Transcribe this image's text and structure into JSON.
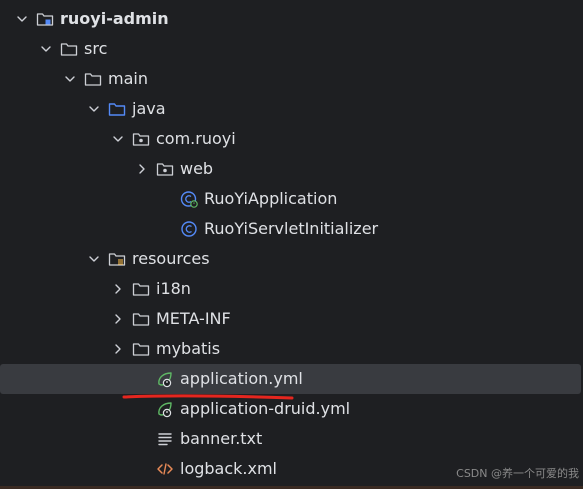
{
  "tree": [
    {
      "label": "ruoyi-admin",
      "indent": 0,
      "chevron": "down",
      "icon": "module-folder",
      "bold": true
    },
    {
      "label": "src",
      "indent": 1,
      "chevron": "down",
      "icon": "folder"
    },
    {
      "label": "main",
      "indent": 2,
      "chevron": "down",
      "icon": "folder"
    },
    {
      "label": "java",
      "indent": 3,
      "chevron": "down",
      "icon": "source-folder"
    },
    {
      "label": "com.ruoyi",
      "indent": 4,
      "chevron": "down",
      "icon": "package"
    },
    {
      "label": "web",
      "indent": 5,
      "chevron": "right",
      "icon": "package"
    },
    {
      "label": "RuoYiApplication",
      "indent": 6,
      "chevron": "none",
      "icon": "spring-class"
    },
    {
      "label": "RuoYiServletInitializer",
      "indent": 6,
      "chevron": "none",
      "icon": "class"
    },
    {
      "label": "resources",
      "indent": 3,
      "chevron": "down",
      "icon": "resources-folder"
    },
    {
      "label": "i18n",
      "indent": 4,
      "chevron": "right",
      "icon": "folder"
    },
    {
      "label": "META-INF",
      "indent": 4,
      "chevron": "right",
      "icon": "folder"
    },
    {
      "label": "mybatis",
      "indent": 4,
      "chevron": "right",
      "icon": "folder"
    },
    {
      "label": "application.yml",
      "indent": 5,
      "chevron": "none",
      "icon": "spring-config",
      "selected": true
    },
    {
      "label": "application-druid.yml",
      "indent": 5,
      "chevron": "none",
      "icon": "spring-config"
    },
    {
      "label": "banner.txt",
      "indent": 5,
      "chevron": "none",
      "icon": "text-file"
    },
    {
      "label": "logback.xml",
      "indent": 5,
      "chevron": "none",
      "icon": "xml-file"
    }
  ],
  "watermark": "CSDN @养一个可爱的我",
  "colors": {
    "background": "#1e1f22",
    "selected": "#393b40",
    "text": "#dfe1e5",
    "folder_stroke": "#ced0d6",
    "source_folder": "#548af7",
    "spring_green": "#5fb865",
    "class_blue": "#548af7",
    "xml_orange": "#e88a57",
    "underline_red": "#e5261f"
  }
}
